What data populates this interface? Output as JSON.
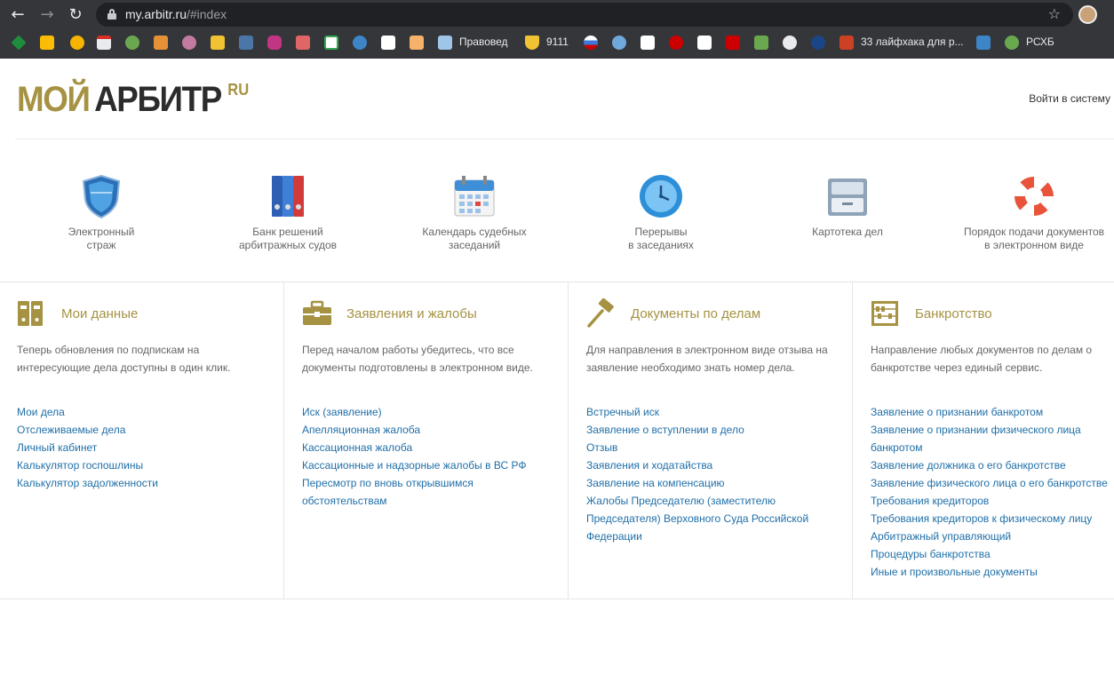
{
  "browser": {
    "url_host": "my.arbitr.ru",
    "url_path": "/#index",
    "bookmarks": [
      "Правовед",
      "9111",
      "33 лайфхака для р...",
      "РСХБ"
    ]
  },
  "site": {
    "logo": {
      "part1": "МОЙ",
      "part2": "АРБИТР",
      "part3": "RU"
    },
    "login": "Войти в систему"
  },
  "services": [
    {
      "label": "Электронный\nстраж",
      "icon": "shield-icon"
    },
    {
      "label": "Банк решений\nарбитражных судов",
      "icon": "binders-icon"
    },
    {
      "label": "Календарь судебных\nзаседаний",
      "icon": "calendar-icon"
    },
    {
      "label": "Перерывы\nв заседаниях",
      "icon": "clock-icon"
    },
    {
      "label": "Картотека дел",
      "icon": "file-cabinet-icon"
    },
    {
      "label": "Порядок подачи документов\nв электронном виде",
      "icon": "lifebuoy-icon"
    }
  ],
  "columns": [
    {
      "title": "Мои данные",
      "icon": "folders-icon",
      "desc": "Теперь обновления по подпискам на интересующие дела доступны в один клик.",
      "links": [
        "Мои дела",
        "Отслеживаемые дела",
        "Личный кабинет",
        "Калькулятор госпошлины",
        "Калькулятор задолженности"
      ]
    },
    {
      "title": "Заявления и жалобы",
      "icon": "briefcase-icon",
      "desc": "Перед началом работы убедитесь, что все документы подготовлены в электронном виде.",
      "links": [
        "Иск (заявление)",
        "Апелляционная жалоба",
        "Кассационная жалоба",
        "Кассационные и надзорные жалобы в ВС РФ",
        "Пересмотр по вновь открывшимся обстоятельствам"
      ]
    },
    {
      "title": "Документы по делам",
      "icon": "gavel-icon",
      "desc": "Для направления в электронном виде отзыва на заявление необходимо знать номер дела.",
      "links": [
        "Встречный иск",
        "Заявление о вступлении в дело",
        "Отзыв",
        "Заявления и ходатайства",
        "Заявление на компенсацию",
        "Жалобы Председателю (заместителю Председателя) Верховного Суда Российской Федерации"
      ]
    },
    {
      "title": "Банкротство",
      "icon": "abacus-icon",
      "desc": "Направление любых документов по делам о банкротстве через единый сервис.",
      "links": [
        "Заявление о признании банкротом",
        "Заявление о признании физического лица банкротом",
        "Заявление должника о его банкротстве",
        "Заявление физического лица о его банкротстве",
        "Требования кредиторов",
        "Требования кредиторов к физическому лицу",
        "Арбитражный управляющий",
        "Процедуры банкротства",
        "Иные и произвольные документы"
      ]
    }
  ],
  "colors": {
    "accent": "#a69243",
    "link": "#1f6fa8",
    "chrome": "#35363a"
  }
}
